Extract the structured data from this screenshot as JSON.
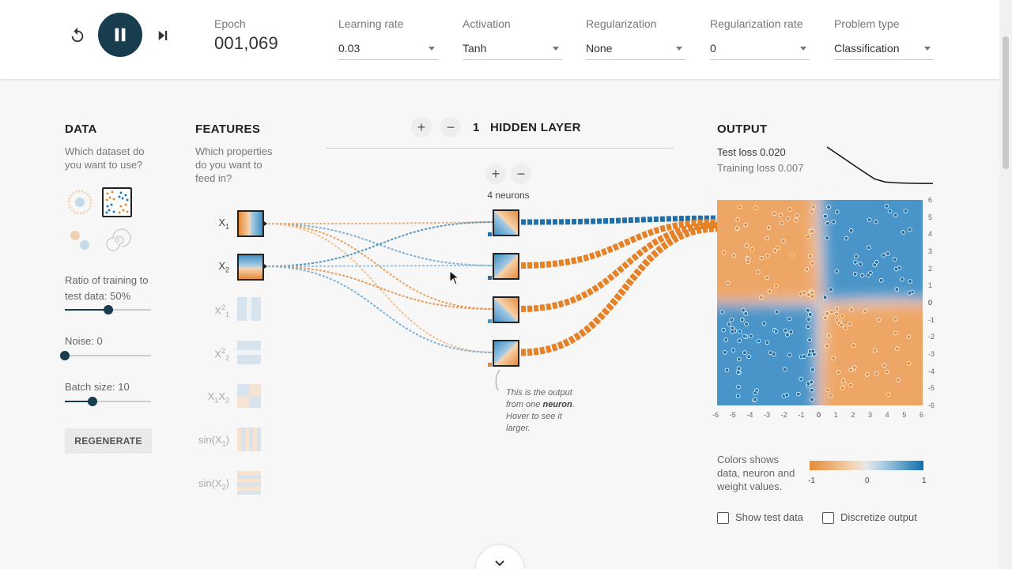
{
  "controls": {
    "epoch_label": "Epoch",
    "epoch_value": "001,069",
    "learning_rate": {
      "label": "Learning rate",
      "value": "0.03"
    },
    "activation": {
      "label": "Activation",
      "value": "Tanh"
    },
    "regularization": {
      "label": "Regularization",
      "value": "None"
    },
    "regularization_rate": {
      "label": "Regularization rate",
      "value": "0"
    },
    "problem_type": {
      "label": "Problem type",
      "value": "Classification"
    }
  },
  "data_panel": {
    "title": "DATA",
    "description": "Which dataset do you want to use?",
    "datasets": [
      "circle",
      "xor",
      "gaussian",
      "spiral"
    ],
    "selected_dataset": "xor",
    "ratio_label": "Ratio of training to test data:",
    "ratio_value": "50%",
    "ratio_fraction": 0.5,
    "noise_label": "Noise:",
    "noise_value": "0",
    "noise_fraction": 0.0,
    "batch_label": "Batch size:",
    "batch_value": "10",
    "batch_fraction": 0.32,
    "regenerate_label": "REGENERATE"
  },
  "features_panel": {
    "title": "FEATURES",
    "description": "Which properties do you want to feed in?",
    "features": [
      {
        "base": "X",
        "sub": "1",
        "sup": "",
        "active": true,
        "pattern": "vertical"
      },
      {
        "base": "X",
        "sub": "2",
        "sup": "",
        "active": true,
        "pattern": "horizontal"
      },
      {
        "base": "X",
        "sub": "1",
        "sup": "2",
        "active": false,
        "pattern": "vertical"
      },
      {
        "base": "X",
        "sub": "2",
        "sup": "2",
        "active": false,
        "pattern": "horizontal"
      },
      {
        "base": "X",
        "sub": "1",
        "sup": "",
        "extra": "X",
        "extra_sub": "2",
        "active": false,
        "pattern": "quadrant"
      },
      {
        "base": "sin(X",
        "sub": "1",
        "sup": "",
        "close": ")",
        "active": false,
        "pattern": "vstripes"
      },
      {
        "base": "sin(X",
        "sub": "2",
        "sup": "",
        "close": ")",
        "active": false,
        "pattern": "hstripes"
      }
    ]
  },
  "network": {
    "hidden_layers_count": "1",
    "hidden_layers_label": "HIDDEN LAYER",
    "neurons_label": "4 neurons",
    "neuron_tip": "This is the output from one neuron. Hover to see it larger.",
    "tip_pre": "This is the output from one ",
    "tip_bold": "neuron",
    "tip_post": ". Hover to see it larger."
  },
  "output_panel": {
    "title": "OUTPUT",
    "test_loss": "Test loss 0.020",
    "training_loss": "Training loss 0.007",
    "axis_ticks": [
      "-6",
      "-5",
      "-4",
      "-3",
      "-2",
      "-1",
      "0",
      "1",
      "2",
      "3",
      "4",
      "5",
      "6"
    ],
    "legend_text": "Colors shows data, neuron and weight values.",
    "legend_min": "-1",
    "legend_mid": "0",
    "legend_max": "1",
    "show_test_label": "Show test data",
    "discretize_label": "Discretize output",
    "show_test_checked": false,
    "discretize_checked": false
  },
  "colors": {
    "orange": "#e58c3a",
    "blue": "#1f77b4",
    "dark_navy": "#183d4e"
  },
  "chart_data": {
    "type": "line",
    "series": [
      {
        "values": [
          0.5,
          0.2,
          0.08,
          0.04,
          0.03,
          0.025,
          0.022,
          0.021,
          0.02,
          0.02,
          0.02
        ]
      }
    ]
  }
}
